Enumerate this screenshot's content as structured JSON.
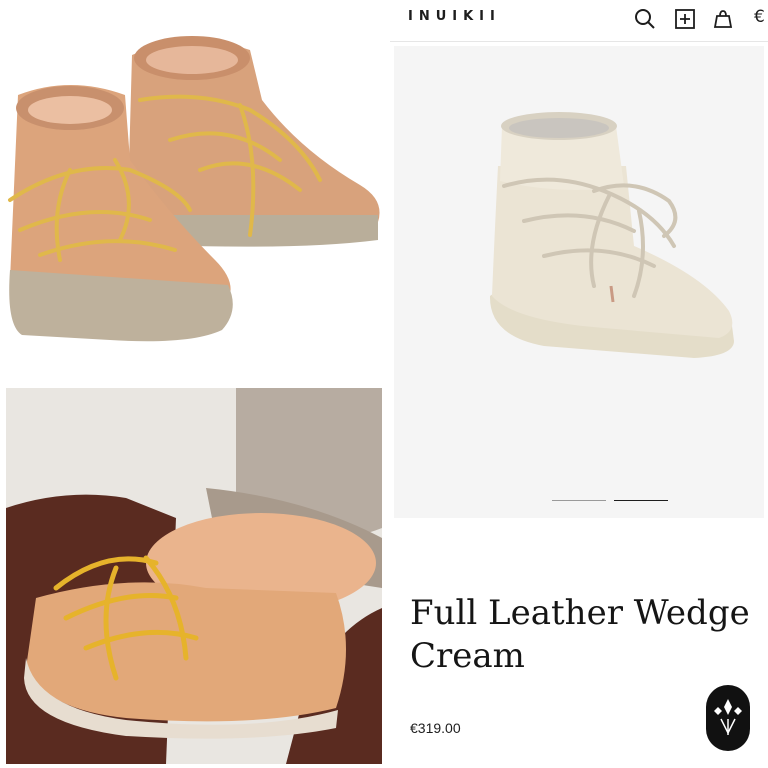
{
  "header": {
    "brand": "INUIKII",
    "icons": [
      "search-icon",
      "plus-box-icon",
      "bag-icon"
    ],
    "currency_symbol": "€"
  },
  "gallery": {
    "slide_count": 2,
    "active_slide": 2
  },
  "product": {
    "title_line1": "Full Leather Wedge",
    "title_line2": "Cream",
    "price": "€319.00"
  },
  "colors": {
    "text": "#1d1d1d",
    "gallery_bg": "#f5f5f5",
    "boot_cream": "#ece5d6",
    "boot_tan": "#d9a07a",
    "lace_yellow": "#e0b84a",
    "chat_badge": "#111111"
  }
}
